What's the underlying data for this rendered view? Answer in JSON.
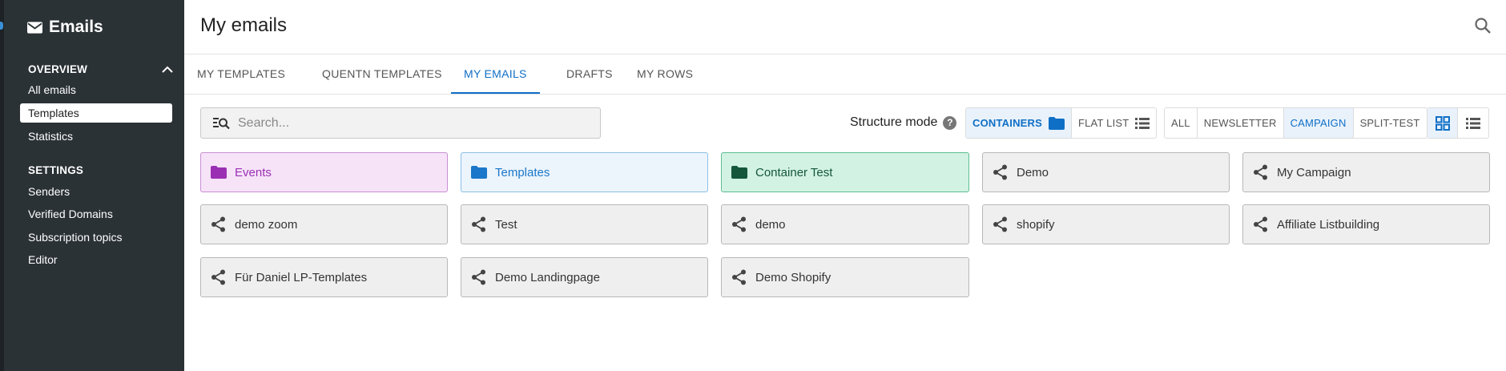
{
  "app": {
    "brand": "Emails",
    "sidebar": {
      "overview_heading": "OVERVIEW",
      "overview_items": [
        {
          "label": "All emails",
          "active": false
        },
        {
          "label": "Templates",
          "active": true
        },
        {
          "label": "Statistics",
          "active": false
        }
      ],
      "settings_heading": "SETTINGS",
      "settings_items": [
        {
          "label": "Senders"
        },
        {
          "label": "Verified Domains"
        },
        {
          "label": "Subscription topics"
        },
        {
          "label": "Editor"
        }
      ]
    }
  },
  "header": {
    "title": "My emails"
  },
  "tabs": [
    {
      "label": "MY TEMPLATES",
      "active": false
    },
    {
      "label": "QUENTN TEMPLATES",
      "active": false
    },
    {
      "label": "MY EMAILS",
      "active": true
    },
    {
      "label": "DRAFTS",
      "active": false
    },
    {
      "label": "MY ROWS",
      "active": false
    }
  ],
  "toolbar": {
    "search_placeholder": "Search...",
    "structure_label": "Structure mode",
    "help": "?",
    "structure_options": [
      {
        "label": "CONTAINERS",
        "icon": "folder-icon",
        "active": true
      },
      {
        "label": "FLAT LIST",
        "icon": "list-icon",
        "active": false
      }
    ],
    "filters": [
      {
        "label": "ALL",
        "active": false
      },
      {
        "label": "NEWSLETTER",
        "active": false
      },
      {
        "label": "CAMPAIGN",
        "active": true
      },
      {
        "label": "SPLIT-TEST",
        "active": false
      }
    ],
    "view_options": [
      {
        "icon": "grid-view-icon",
        "active": true
      },
      {
        "icon": "list-view-icon",
        "active": false
      }
    ]
  },
  "colors": {
    "accent": "#0f6fc6",
    "sidebar_bg": "#2b3236",
    "folder_purple": "#9b2fb4",
    "folder_blue": "#1a77c9",
    "folder_green": "#14573a"
  },
  "items": [
    {
      "label": "Events",
      "type": "folder",
      "color": "purple"
    },
    {
      "label": "Templates",
      "type": "folder",
      "color": "blue"
    },
    {
      "label": "Container Test",
      "type": "folder",
      "color": "green"
    },
    {
      "label": "Demo",
      "type": "campaign"
    },
    {
      "label": "My Campaign",
      "type": "campaign"
    },
    {
      "label": "demo zoom",
      "type": "campaign"
    },
    {
      "label": "Test",
      "type": "campaign"
    },
    {
      "label": "demo",
      "type": "campaign"
    },
    {
      "label": "shopify",
      "type": "campaign"
    },
    {
      "label": "Affiliate Listbuilding",
      "type": "campaign"
    },
    {
      "label": "Für Daniel LP-Templates",
      "type": "campaign"
    },
    {
      "label": "Demo Landingpage",
      "type": "campaign"
    },
    {
      "label": "Demo Shopify",
      "type": "campaign"
    }
  ]
}
